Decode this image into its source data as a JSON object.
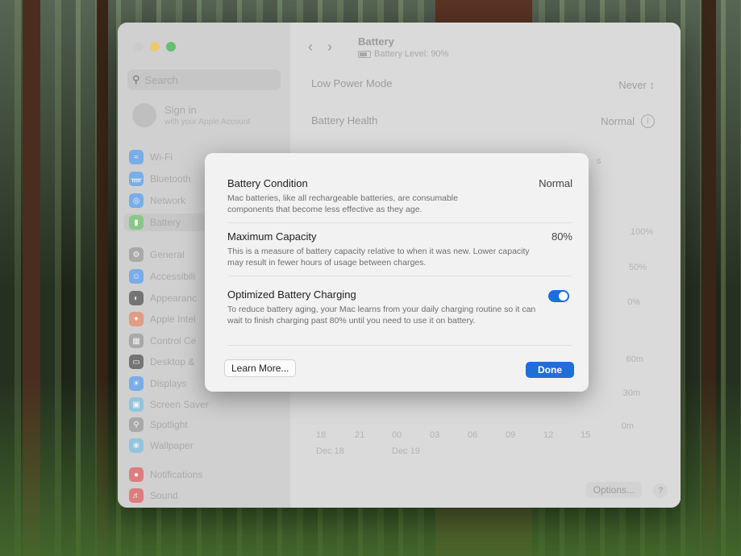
{
  "sidebar": {
    "search_placeholder": "Search",
    "signin_title": "Sign in",
    "signin_subtitle": "with your Apple Account",
    "items": [
      {
        "label": "Wi-Fi",
        "icon": "wifi-icon",
        "color": "#5aa0f0"
      },
      {
        "label": "Bluetooth",
        "icon": "bluetooth-icon",
        "color": "#5aa0f0"
      },
      {
        "label": "Network",
        "icon": "globe-icon",
        "color": "#5aa0f0"
      },
      {
        "label": "Battery",
        "icon": "battery-icon",
        "color": "#6ec46e"
      },
      {
        "label": "General",
        "icon": "gear-icon",
        "color": "#9b9b9b"
      },
      {
        "label": "Accessibili",
        "icon": "accessibility-icon",
        "color": "#5aa0f0"
      },
      {
        "label": "Appearanc",
        "icon": "appearance-icon",
        "color": "#555555"
      },
      {
        "label": "Apple Intel",
        "icon": "apple-intelligence-icon",
        "color": "#e58a6a"
      },
      {
        "label": "Control Ce",
        "icon": "control-center-icon",
        "color": "#9b9b9b"
      },
      {
        "label": "Desktop &",
        "icon": "desktop-icon",
        "color": "#555555"
      },
      {
        "label": "Displays",
        "icon": "displays-icon",
        "color": "#5aa0f0"
      },
      {
        "label": "Screen Saver",
        "icon": "screen-saver-icon",
        "color": "#7cc0e0"
      },
      {
        "label": "Spotlight",
        "icon": "spotlight-icon",
        "color": "#9b9b9b"
      },
      {
        "label": "Wallpaper",
        "icon": "wallpaper-icon",
        "color": "#7cc0e0"
      },
      {
        "label": "Notifications",
        "icon": "notifications-icon",
        "color": "#e06060"
      },
      {
        "label": "Sound",
        "icon": "sound-icon",
        "color": "#e06060"
      }
    ]
  },
  "header": {
    "title": "Battery",
    "subtitle": "Battery Level: 90%"
  },
  "settings": {
    "low_power_label": "Low Power Mode",
    "low_power_value": "Never ↕",
    "health_label": "Battery Health",
    "health_value": "Normal",
    "info_glyph": "i"
  },
  "chart": {
    "y_labels_top": [
      "100%",
      "50%",
      "0%"
    ],
    "y_labels_bottom": [
      "60m",
      "30m",
      "0m"
    ],
    "x_labels": [
      "18",
      "21",
      "00",
      "03",
      "06",
      "09",
      "12",
      "15"
    ],
    "date_labels": [
      "Dec 18",
      "Dec 19"
    ],
    "fragment_s": "s"
  },
  "footer": {
    "options_label": "Options...",
    "help_label": "?"
  },
  "sheet": {
    "condition_title": "Battery Condition",
    "condition_value": "Normal",
    "condition_desc": "Mac batteries, like all rechargeable batteries, are consumable components that become less effective as they age.",
    "capacity_title": "Maximum Capacity",
    "capacity_value": "80%",
    "capacity_desc": "This is a measure of battery capacity relative to when it was new. Lower capacity may result in fewer hours of usage between charges.",
    "optimized_title": "Optimized Battery Charging",
    "optimized_desc": "To reduce battery aging, your Mac learns from your daily charging routine so it can wait to finish charging past 80% until you need to use it on battery.",
    "learn_more_label": "Learn More...",
    "done_label": "Done"
  }
}
